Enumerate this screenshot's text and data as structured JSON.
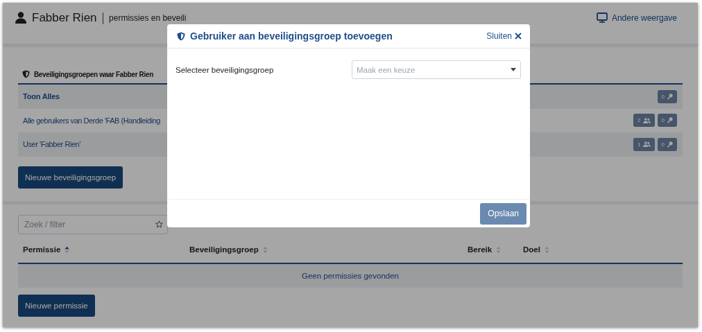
{
  "header": {
    "name": "Fabber Rien",
    "subtitle": "permissies en beveili",
    "view_link": "Andere weergave"
  },
  "groups": {
    "heading": "Beveiligingsgroepen waar Fabber Rien",
    "rows": [
      {
        "label": "Toon Alles",
        "selected": true,
        "badges": [
          {
            "count": "0",
            "kind": "key"
          }
        ]
      },
      {
        "label": "Alle gebruikers van Derde 'FAB (Handleiding",
        "selected": false,
        "badges": [
          {
            "count": "2",
            "kind": "users"
          },
          {
            "count": "0",
            "kind": "key"
          }
        ]
      },
      {
        "label": "User 'Fabber Rien'",
        "selected": false,
        "badges": [
          {
            "count": "1",
            "kind": "users"
          },
          {
            "count": "0",
            "kind": "key"
          }
        ]
      }
    ],
    "new_button": "Nieuwe beveiligingsgroep"
  },
  "permissions": {
    "search": {
      "placeholder": "Zoek / filter"
    },
    "columns": [
      {
        "label": "Permissie",
        "sorted": true
      },
      {
        "label": "Beveiligingsgroep",
        "sorted": false
      },
      {
        "label": "Bereik",
        "sorted": false
      },
      {
        "label": "Doel",
        "sorted": false
      }
    ],
    "empty": "Geen permissies gevonden",
    "new_button": "Nieuwe permissie"
  },
  "dialog": {
    "title": "Gebruiker aan beveiligingsgroep toevoegen",
    "close": "Sluiten",
    "field_label": "Selecteer beveiligingsgroep",
    "select": {
      "placeholder": "Maak een keuze"
    },
    "save": {
      "label": "Opslaan",
      "disabled": true
    }
  }
}
